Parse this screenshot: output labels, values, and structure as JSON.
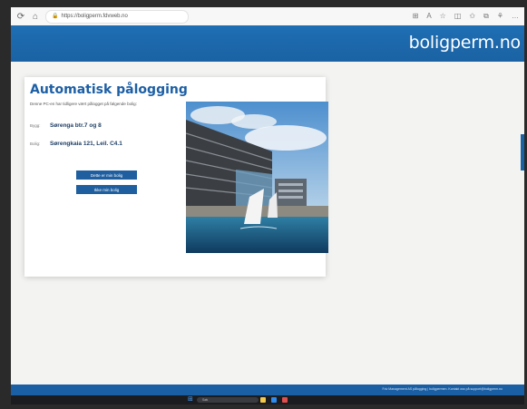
{
  "browser": {
    "url": "https://boligperm.fdvweb.no",
    "icons": [
      "reload-icon",
      "home-icon",
      "apps-icon",
      "read-aloud-icon",
      "favorite-icon",
      "split-icon",
      "favorites-bar-icon",
      "collections-icon",
      "profile-icon",
      "more-icon"
    ]
  },
  "header": {
    "brand": "boligperm.no",
    "color": "#1f6eb4"
  },
  "login": {
    "title": "Automatisk pålogging",
    "subtitle": "Denne PC-en har tidligere vært pålogget på følgende bolig:",
    "rows": [
      {
        "label": "Bygg:",
        "value": "Sørenga btr.7 og 8"
      },
      {
        "label": "Bolig:",
        "value": "Sørengkaia 121, Leil. C4.1"
      }
    ],
    "buttons": {
      "primary": "Dette er min bolig",
      "secondary": "Ikke min bolig"
    }
  },
  "footer": {
    "text": "Fdv Management AS pålogging | boligpermen. Kontakt oss på support@boligperm.no"
  },
  "taskbar": {
    "search_placeholder": "Søk"
  }
}
